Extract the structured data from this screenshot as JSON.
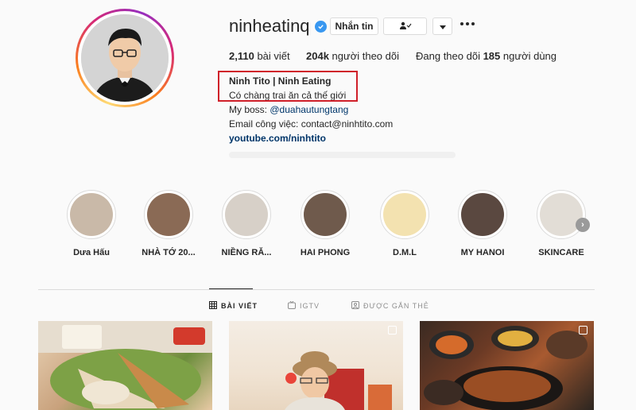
{
  "profile": {
    "username": "ninheatinq",
    "message_label": "Nhắn tin",
    "stats": {
      "posts_count": "2,110",
      "posts_label": "bài viết",
      "followers_count": "204k",
      "followers_label": "người theo dõi",
      "following_prefix": "Đang theo dõi",
      "following_count": "185",
      "following_label": "người dùng"
    },
    "bio": {
      "name": "Ninh Tito | Ninh Eating",
      "tagline": "Có chàng trai ăn cả thế giới",
      "boss_prefix": "My boss: ",
      "boss_handle": "@duahautungtang",
      "email": "Email công việc: contact@ninhtito.com",
      "website": "youtube.com/ninhtito"
    }
  },
  "stories": [
    {
      "label": "Dưa Hấu",
      "color": "#c9b9a8"
    },
    {
      "label": "NHÀ TỚ 20...",
      "color": "#8a6a55"
    },
    {
      "label": "NIỀNG RĂ...",
      "color": "#d7d0c8"
    },
    {
      "label": "HAI PHONG",
      "color": "#6f5a4c"
    },
    {
      "label": "D.M.L",
      "color": "#f3e2b0"
    },
    {
      "label": "MY HANOI",
      "color": "#5a4840"
    },
    {
      "label": "SKINCARE",
      "color": "#e2ddd6"
    }
  ],
  "tabs": [
    {
      "label": "BÀI VIẾT",
      "icon": "grid-icon"
    },
    {
      "label": "IGTV",
      "icon": "igtv-icon"
    },
    {
      "label": "ĐƯỢC GẮN THẺ",
      "icon": "tag-icon"
    }
  ],
  "colors": {
    "highlight_box": "#d0202a",
    "verified": "#3897f0",
    "link": "#00376b"
  }
}
